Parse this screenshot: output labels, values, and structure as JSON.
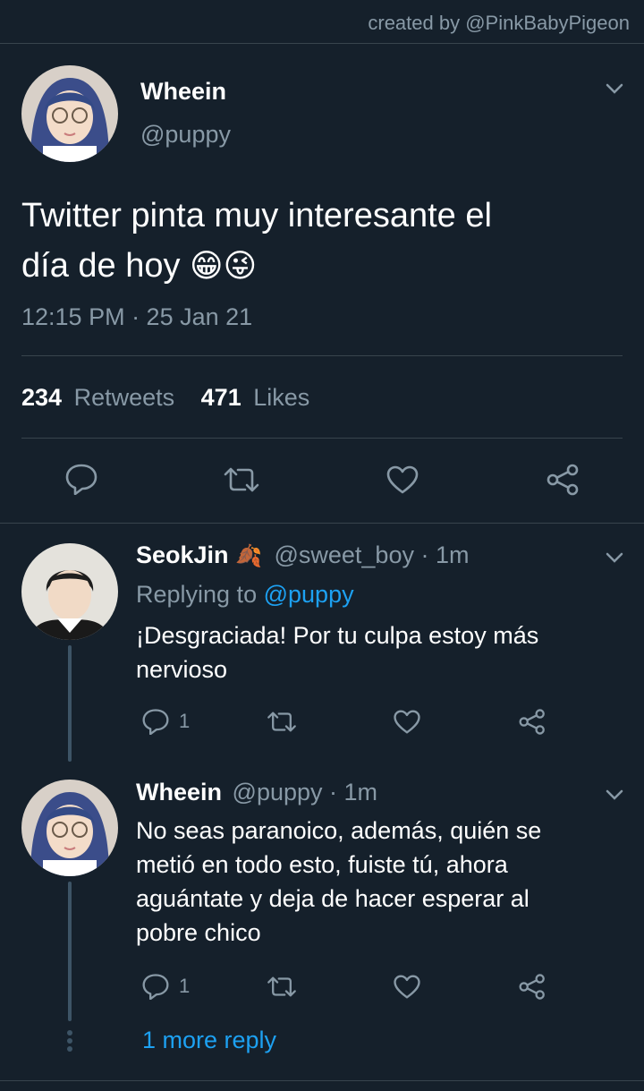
{
  "credit": "created by @PinkBabyPigeon",
  "main_tweet": {
    "name": "Wheein",
    "handle": "@puppy",
    "text_line1": "Twitter pinta muy interesante el",
    "text_line2": "día de hoy",
    "emoji": "😁😜",
    "timestamp": "12:15 PM · 25 Jan 21",
    "retweets_count": "234",
    "retweets_label": "Retweets",
    "likes_count": "471",
    "likes_label": "Likes"
  },
  "replies": [
    {
      "name": "SeokJin",
      "name_emoji": "🍂",
      "handle": "@sweet_boy",
      "time": "· 1m",
      "replying_prefix": "Replying to",
      "replying_to": "@puppy",
      "text_line1": "¡Desgraciada! Por tu culpa estoy más",
      "text_line2": "nervioso",
      "reply_count": "1"
    },
    {
      "name": "Wheein",
      "handle": "@puppy",
      "time": "· 1m",
      "text_line1": "No seas paranoico, además, quién se",
      "text_line2": "metió en todo esto, fuiste tú, ahora",
      "text_line3": "aguántate y deja de hacer esperar al",
      "text_line4": "pobre chico",
      "reply_count": "1"
    }
  ],
  "more_replies": "1 more reply",
  "colors": {
    "background": "#15202b",
    "muted": "#8899a6",
    "accent": "#1da1f2",
    "divider": "#38444d"
  }
}
